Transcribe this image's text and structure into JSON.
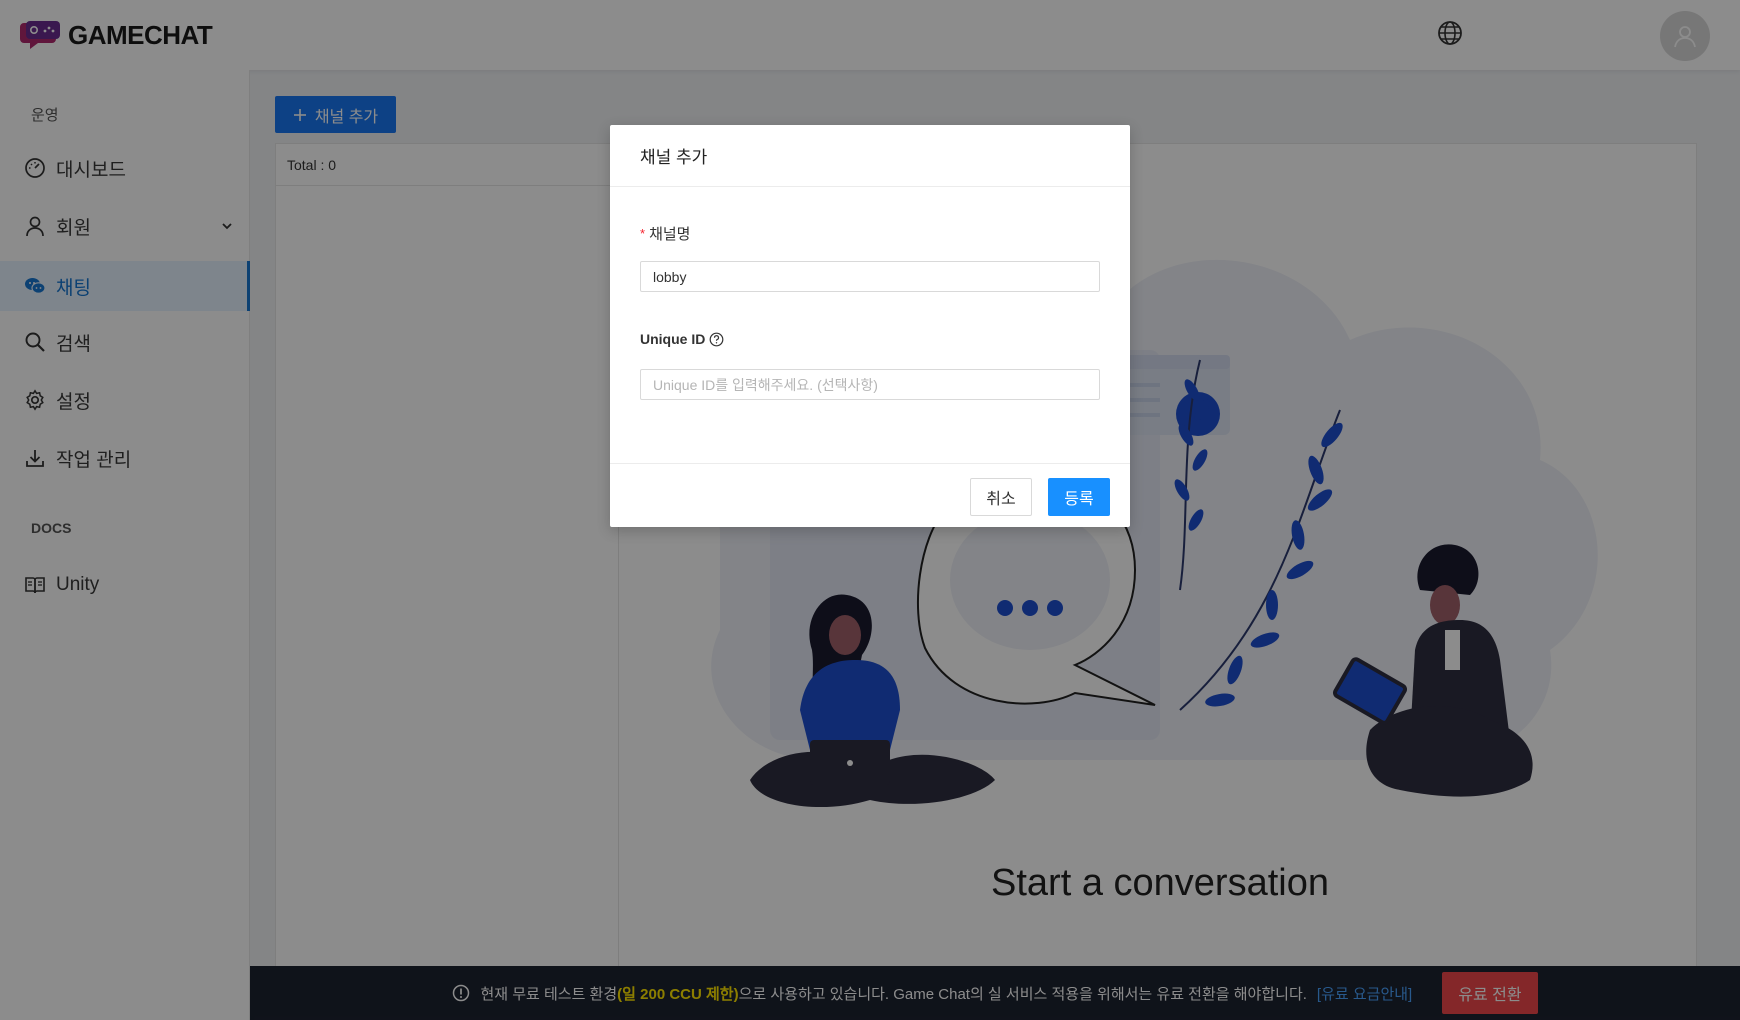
{
  "header": {
    "app_name": "GAMECHAT"
  },
  "sidebar": {
    "group_ops": "운영",
    "items": [
      {
        "label": "대시보드",
        "icon": "dashboard-icon"
      },
      {
        "label": "회원",
        "icon": "user-icon"
      },
      {
        "label": "채팅",
        "icon": "chat-icon"
      },
      {
        "label": "검색",
        "icon": "search-icon"
      },
      {
        "label": "설정",
        "icon": "gear-icon"
      },
      {
        "label": "작업 관리",
        "icon": "download-icon"
      }
    ],
    "group_docs": "DOCS",
    "docs_items": [
      {
        "label": "Unity",
        "icon": "book-icon"
      }
    ]
  },
  "main": {
    "add_button": "채널 추가",
    "total": "Total : 0",
    "empty_title": "Start a conversation"
  },
  "modal": {
    "title": "채널 추가",
    "channel_name_label": "채널명",
    "channel_name_value": "lobby",
    "unique_id_label": "Unique ID",
    "unique_id_placeholder": "Unique ID를 입력해주세요. (선택사항)",
    "cancel": "취소",
    "submit": "등록"
  },
  "banner": {
    "text_prefix": "현재 무료 테스트 환경",
    "highlight": "(일 200 CCU 제한)",
    "text_suffix": "으로 사용하고 있습니다. Game Chat의 실 서비스 적용을 위해서는 유료 전환을 해야합니다.",
    "link": "[유료 요금안내]",
    "upgrade_button": "유료 전환"
  },
  "colors": {
    "primary": "#1877f2",
    "danger": "#f0484b",
    "highlight": "#ffe600",
    "banner_bg": "#1d2331"
  }
}
